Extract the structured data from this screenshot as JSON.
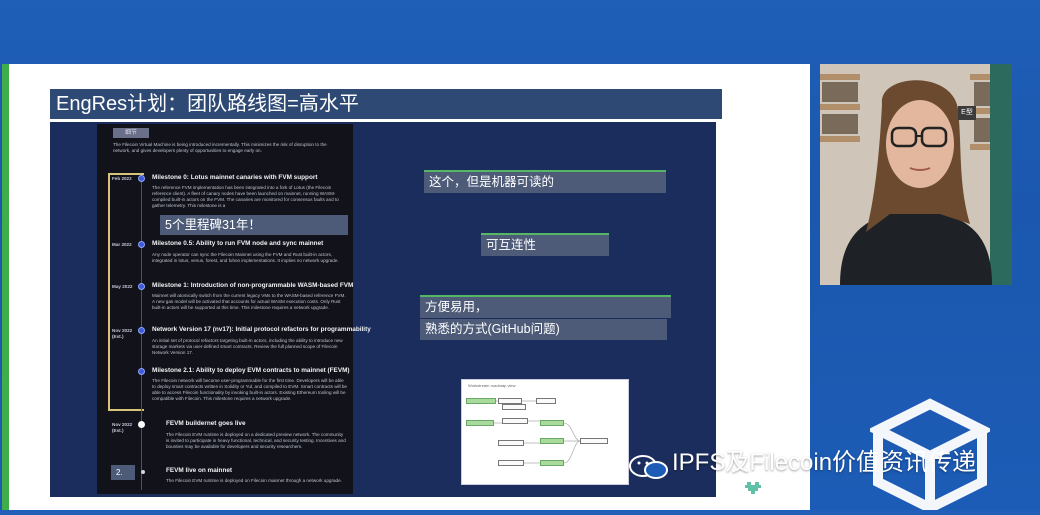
{
  "slide": {
    "title": "EngRes计划：团队路线图=高水平",
    "captions": [
      "5个里程碑31年！",
      "这个，但是机器可读的",
      "可互连性",
      "方便易用，",
      "熟悉的方式(GitHub问题)"
    ]
  },
  "roadmap": {
    "header": "细节",
    "intro": "The Filecoin Virtual Machine is being introduced incrementally. This minimizes the risk of disruption to the network, and gives developers plenty of opportunities to engage early on.",
    "milestones": [
      {
        "date": "Feb 2022",
        "title": "Milestone 0: Lotus mainnet canaries with FVM support",
        "body": "The reference FVM implementation has been integrated into a fork of Lotus (the Filecoin reference client). A fleet of canary nodes have been launched on mainnet, running WASM-compiled built-in actors on the FVM. The canaries are monitored for consensus faults and to gather telemetry. This milestone is a"
      },
      {
        "date": "Mar 2022",
        "title": "Milestone 0.5: Ability to run FVM node and sync mainnet",
        "body": "Any node operator can sync the Filecoin Mainnet using the FVM and Rust built-in actors, integrated in lotus, venus, forest, and fuhon implementations. It implies no network upgrade."
      },
      {
        "date": "May 2022",
        "title": "Milestone 1: Introduction of non-programmable WASM-based FVM",
        "body": "Mainnet will atomically switch from the current legacy VMs to the WASM-based reference FVM. A new gas model will be activated that accounts for actual WASM execution costs. Only Rust built-in actors will be supported at this time. This milestone requires a network upgrade."
      },
      {
        "date": "Nov 2022 (Est.)",
        "title": "Network Version 17 (nv17): Initial protocol refactors for programmability",
        "body": "An initial set of protocol refactors targeting built-in actors, including the ability to introduce new storage markets via user-defined smart contracts. Review the full planned scope of Filecoin Network Version 17."
      },
      {
        "date": "",
        "title": "Milestone 2.1: Ability to deploy EVM contracts to mainnet (FEVM)",
        "body": "The Filecoin network will become user-programmable for the first time. Developers will be able to deploy smart contracts written in Solidity or Yul, and compiled to EVM. Smart contracts will be able to access Filecoin functionality by invoking built-in actors. Existing Ethereum tooling will be compatible with Filecoin. This milestone requires a network upgrade."
      },
      {
        "date": "Nov 2022 (Est.)",
        "title": "FEVM buildernet goes live",
        "body": "The Filecoin EVM runtime is deployed on a dedicated preview network. The community is invited to participate in heavy functional, technical, and security testing. Incentives and bounties may be available for developers and security researchers."
      },
      {
        "date": "",
        "title": "FEVM live on mainnet",
        "body": "The Filecoin EVM runtime is deployed on Filecoin mainnet through a network upgrade."
      }
    ],
    "page_marker": "2."
  },
  "diagram": {
    "title": "Workstream roadmap view"
  },
  "webcam": {
    "label": "E型"
  },
  "watermark": {
    "text": "IPFS及Filecoin价值资讯传递"
  }
}
